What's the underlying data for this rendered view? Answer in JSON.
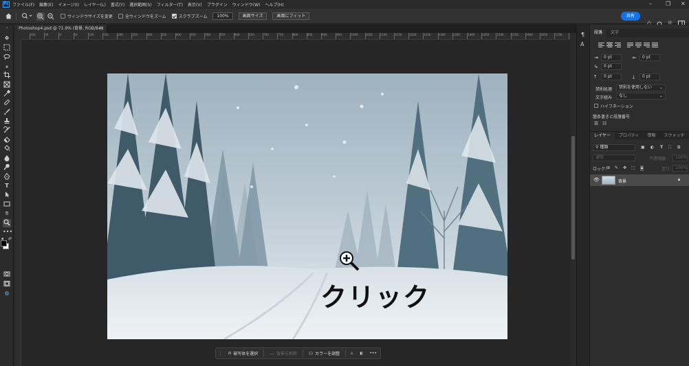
{
  "menubar": {
    "items": [
      "ファイル(F)",
      "編集(E)",
      "イメージ(I)",
      "レイヤー(L)",
      "書式(Y)",
      "選択範囲(S)",
      "フィルター(T)",
      "表示(V)",
      "プラグイン",
      "ウィンドウ(W)",
      "ヘルプ(H)"
    ]
  },
  "options": {
    "resize_windows": "ウィンドウサイズを変更",
    "zoom_all": "全ウィンドウをズーム",
    "scrubby_zoom": "スクラブズーム",
    "zoom_value": "100%",
    "fit_screen": "画面サイズ",
    "fill_screen": "画面にフィット",
    "share": "共有",
    "resize_checked": false,
    "zoom_all_checked": false,
    "scrubby_checked": true
  },
  "document": {
    "tab_title": "Photoshop4.psd @ 71.9% (背景, RGB/8#)",
    "close": "×"
  },
  "ruler": {
    "labels": [
      "100",
      "50",
      "0",
      "50",
      "100",
      "150",
      "200",
      "250",
      "300",
      "350",
      "400",
      "450",
      "500",
      "550",
      "600",
      "650",
      "700",
      "750",
      "800",
      "850",
      "900",
      "950",
      "1000",
      "1050",
      "1100",
      "1150",
      "1200",
      "1250",
      "1300",
      "1350",
      "1400",
      "1450",
      "1500",
      "1550",
      "1600",
      "1650",
      "1700",
      "1750"
    ]
  },
  "canvas": {
    "overlay_text": "クリック"
  },
  "contextual_bar": {
    "select_subject": "被写体を選択",
    "remove_bg": "背景を削除",
    "adjust_color": "カラーを調整",
    "more": "•••"
  },
  "panel_top": {
    "tabs": [
      "段落",
      "文字"
    ],
    "indent_left": "0 pt",
    "indent_right": "0 pt",
    "indent_first": "0 pt",
    "space_before": "0 pt",
    "space_after": "0 pt",
    "kinsoku_label": "禁則処理",
    "kinsoku_value": "禁則を使用しない",
    "mojikumi_label": "文字組み",
    "mojikumi_value": "なし",
    "hyphenation": "ハイフネーション",
    "bullets_label": "箇条書きと段落番号"
  },
  "layers": {
    "tabs": [
      "レイヤー",
      "プロパティ",
      "情報",
      "スウォッチ"
    ],
    "filter_kind": "種類",
    "blend_mode": "通常",
    "opacity_label": "不透明度：",
    "opacity_value": "100%",
    "lock_label": "ロック：",
    "fill_label": "塗り：",
    "fill_value": "100%",
    "items": [
      {
        "name": "背景",
        "visible": true,
        "locked": true
      }
    ]
  },
  "colors": {
    "accent": "#1473e6",
    "ps_blue": "#31a8ff"
  }
}
